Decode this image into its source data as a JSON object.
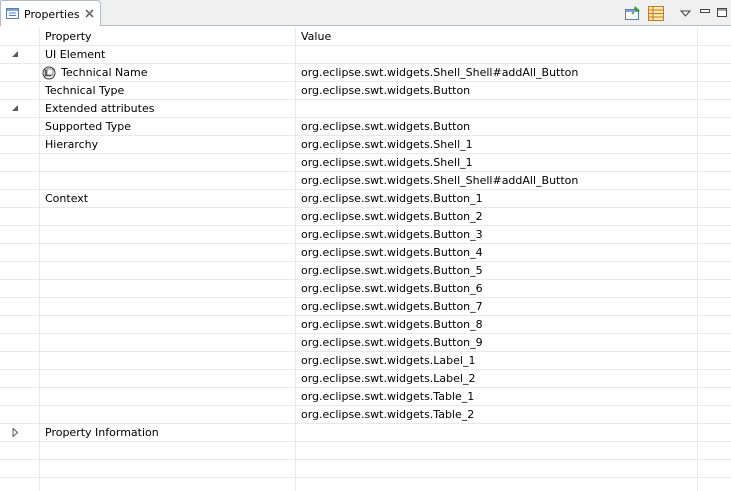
{
  "tab": {
    "title": "Properties",
    "icon": "properties-view-icon",
    "close_icon": "close-icon"
  },
  "toolbar": {
    "items": [
      "pin-to-selection-icon",
      "show-categories-icon",
      "view-menu-icon",
      "minimize-icon",
      "maximize-icon"
    ]
  },
  "table": {
    "columns": [
      "Property",
      "Value"
    ],
    "rows": [
      {
        "expander": "expanded",
        "property": "UI Element",
        "value": ""
      },
      {
        "expander": "",
        "property": "Technical Name",
        "value": "org.eclipse.swt.widgets.Shell_Shell#addAll_Button",
        "icon": "technical-name-icon"
      },
      {
        "expander": "",
        "property": "Technical Type",
        "value": "org.eclipse.swt.widgets.Button"
      },
      {
        "expander": "expanded",
        "property": "Extended attributes",
        "value": ""
      },
      {
        "expander": "",
        "property": "Supported Type",
        "value": "org.eclipse.swt.widgets.Button"
      },
      {
        "expander": "",
        "property": "Hierarchy",
        "value": "org.eclipse.swt.widgets.Shell_1"
      },
      {
        "expander": "",
        "property": "",
        "value": "org.eclipse.swt.widgets.Shell_1"
      },
      {
        "expander": "",
        "property": "",
        "value": "org.eclipse.swt.widgets.Shell_Shell#addAll_Button"
      },
      {
        "expander": "",
        "property": "Context",
        "value": "org.eclipse.swt.widgets.Button_1"
      },
      {
        "expander": "",
        "property": "",
        "value": "org.eclipse.swt.widgets.Button_2"
      },
      {
        "expander": "",
        "property": "",
        "value": "org.eclipse.swt.widgets.Button_3"
      },
      {
        "expander": "",
        "property": "",
        "value": "org.eclipse.swt.widgets.Button_4"
      },
      {
        "expander": "",
        "property": "",
        "value": "org.eclipse.swt.widgets.Button_5"
      },
      {
        "expander": "",
        "property": "",
        "value": "org.eclipse.swt.widgets.Button_6"
      },
      {
        "expander": "",
        "property": "",
        "value": "org.eclipse.swt.widgets.Button_7"
      },
      {
        "expander": "",
        "property": "",
        "value": "org.eclipse.swt.widgets.Button_8"
      },
      {
        "expander": "",
        "property": "",
        "value": "org.eclipse.swt.widgets.Button_9"
      },
      {
        "expander": "",
        "property": "",
        "value": "org.eclipse.swt.widgets.Label_1"
      },
      {
        "expander": "",
        "property": "",
        "value": "org.eclipse.swt.widgets.Label_2"
      },
      {
        "expander": "",
        "property": "",
        "value": "org.eclipse.swt.widgets.Table_1"
      },
      {
        "expander": "",
        "property": "",
        "value": "org.eclipse.swt.widgets.Table_2"
      },
      {
        "expander": "collapsed",
        "property": "Property Information",
        "value": ""
      },
      {
        "expander": "",
        "property": "",
        "value": ""
      },
      {
        "expander": "",
        "property": "",
        "value": ""
      },
      {
        "expander": "",
        "property": "",
        "value": ""
      }
    ]
  },
  "colors": {
    "tab_border": "#b7bcc4",
    "grid_line": "#e9e9e9",
    "tabbar_bg": "#f0f0f0"
  }
}
